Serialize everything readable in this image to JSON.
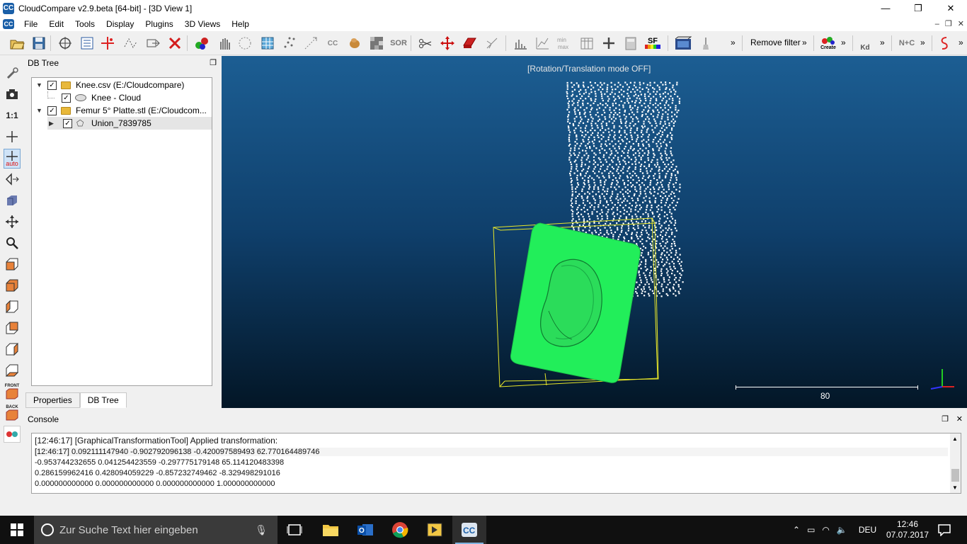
{
  "window": {
    "title": "CloudCompare v2.9.beta [64-bit] - [3D View 1]",
    "app_icon": "CC",
    "controls": {
      "minimize": "—",
      "maximize": "❐",
      "close": "✕"
    }
  },
  "menu": {
    "items": [
      "File",
      "Edit",
      "Tools",
      "Display",
      "Plugins",
      "3D Views",
      "Help"
    ],
    "mdi_controls": [
      "–",
      "❐",
      "✕"
    ]
  },
  "toolbar": {
    "remove_filter": "Remove filter",
    "sf_label": "SF",
    "sor_label": "SOR",
    "cc_label": "CC",
    "kd_label": "Kd",
    "nc_label": "N+C",
    "create_label": "Create",
    "overflow": "»"
  },
  "left_tools": {
    "one_to_one": "1:1",
    "auto": "auto",
    "front": "FRONT",
    "back": "BACK"
  },
  "db_tree": {
    "title": "DB Tree",
    "items": [
      {
        "label": "Knee.csv (E:/Cloudcompare)",
        "type": "folder",
        "checked": true,
        "expanded": true
      },
      {
        "label": "Knee - Cloud",
        "type": "cloud",
        "checked": true
      },
      {
        "label": "Femur 5° Platte.stl (E:/Cloudcom...",
        "type": "folder",
        "checked": true,
        "expanded": true
      },
      {
        "label": "Union_7839785",
        "type": "mesh",
        "checked": true,
        "expanded": false,
        "selected": true
      }
    ],
    "tabs": [
      "Properties",
      "DB Tree"
    ]
  },
  "view3d": {
    "mode_text": "[Rotation/Translation mode OFF]",
    "scale_value": "80",
    "colors": {
      "mesh": "#22ee5a",
      "bbox": "#e8e62a",
      "points": "#ffffff"
    }
  },
  "console": {
    "title": "Console",
    "lines": [
      "[12:46:17] [GraphicalTransformationTool] Applied transformation:",
      "[12:46:17] 0.092111147940 -0.902792096138 -0.420097589493 62.770164489746",
      "-0.953744232655 0.041254423559 -0.297775179148 65.114120483398",
      "0.286159962416 0.428094059229 -0.857232749462 -8.329498291016",
      "0.000000000000 0.000000000000 0.000000000000 1.000000000000"
    ]
  },
  "taskbar": {
    "search_placeholder": "Zur Suche Text hier eingeben",
    "language": "DEU",
    "time": "12:46",
    "date": "07.07.2017"
  }
}
